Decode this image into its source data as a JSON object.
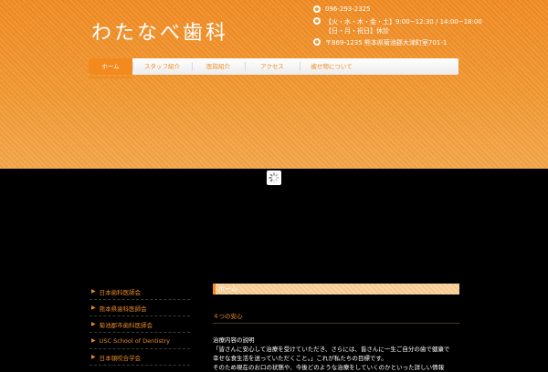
{
  "header": {
    "logo": "わたなべ歯科",
    "phone": "096-293-2325",
    "hours_line1": "【火・水・木・金・土】9:00~12:30 / 14:00~18:00",
    "hours_line2": "【日・月・祝日】休診",
    "address": "〒869-1235 熊本県菊池郡大津町室701-1"
  },
  "nav": [
    {
      "label": "ホーム"
    },
    {
      "label": "スタッフ紹介"
    },
    {
      "label": "医院紹介"
    },
    {
      "label": "アクセス"
    },
    {
      "label": "被せ物について"
    }
  ],
  "sidebar": [
    {
      "label": "日本歯科医師会"
    },
    {
      "label": "熊本県歯科医師会"
    },
    {
      "label": "菊池郡市歯科医師会"
    },
    {
      "label": "USC School of Dentistry"
    },
    {
      "label": "日本顎咬合学会"
    }
  ],
  "content": {
    "breadcrumb": "ホーム",
    "subtitle": "４つの安心",
    "body": [
      "治療内容の説明",
      "「皆さんに安心して治療を受けていただき、さらには、皆さんに一生ご自分の歯で健康で",
      "幸せな食生活を送っていただくこと。」これが私たちの目標です。",
      "そのため現在のお口の状態や、今後どのような治療をしていくのかといった詳しい情報"
    ]
  },
  "colors": {
    "accent": "#f28a1e",
    "header_bg": "#f39a34",
    "page_bg": "#000000"
  }
}
